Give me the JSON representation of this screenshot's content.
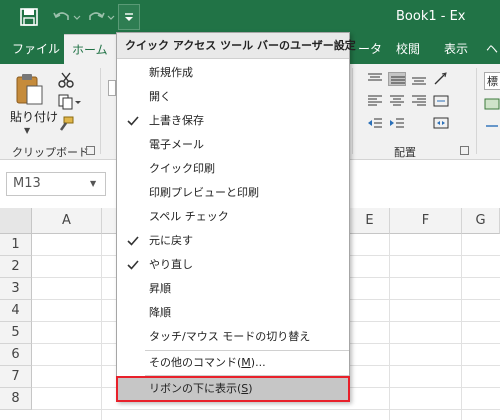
{
  "window": {
    "title": "Book1 - Ex"
  },
  "tabs": [
    {
      "label": "ファイル"
    },
    {
      "label": "ホーム"
    },
    {
      "label": "ータ"
    },
    {
      "label": "校閲"
    },
    {
      "label": "表示"
    },
    {
      "label": "ヘ"
    }
  ],
  "ribbon": {
    "paste_label": "貼り付け",
    "clipboard_group": "クリップボード",
    "alignment_group": "配置",
    "number_format_text": "標"
  },
  "formula_bar": {
    "name_box": "M13"
  },
  "grid": {
    "columns": [
      "A",
      "E",
      "F",
      "G"
    ],
    "rows": [
      "1",
      "2",
      "3",
      "4",
      "5",
      "6",
      "7",
      "8"
    ]
  },
  "qat_menu": {
    "header": "クイック アクセス ツール バーのユーザー設定",
    "items": [
      {
        "label": "新規作成",
        "checked": false
      },
      {
        "label": "開く",
        "checked": false
      },
      {
        "label": "上書き保存",
        "checked": true
      },
      {
        "label": "電子メール",
        "checked": false
      },
      {
        "label": "クイック印刷",
        "checked": false
      },
      {
        "label": "印刷プレビューと印刷",
        "checked": false
      },
      {
        "label": "スペル チェック",
        "checked": false
      },
      {
        "label": "元に戻す",
        "checked": true
      },
      {
        "label": "やり直し",
        "checked": true
      },
      {
        "label": "昇順",
        "checked": false
      },
      {
        "label": "降順",
        "checked": false
      },
      {
        "label": "タッチ/マウス モードの切り替え",
        "checked": false
      }
    ],
    "more_commands": {
      "before": "その他のコマンド(",
      "key": "M",
      "after": ")..."
    },
    "show_below": {
      "before": "リボンの下に表示(",
      "key": "S",
      "after": ")"
    }
  },
  "colors": {
    "brand_green": "#217346",
    "highlight_border": "#e8202a"
  }
}
